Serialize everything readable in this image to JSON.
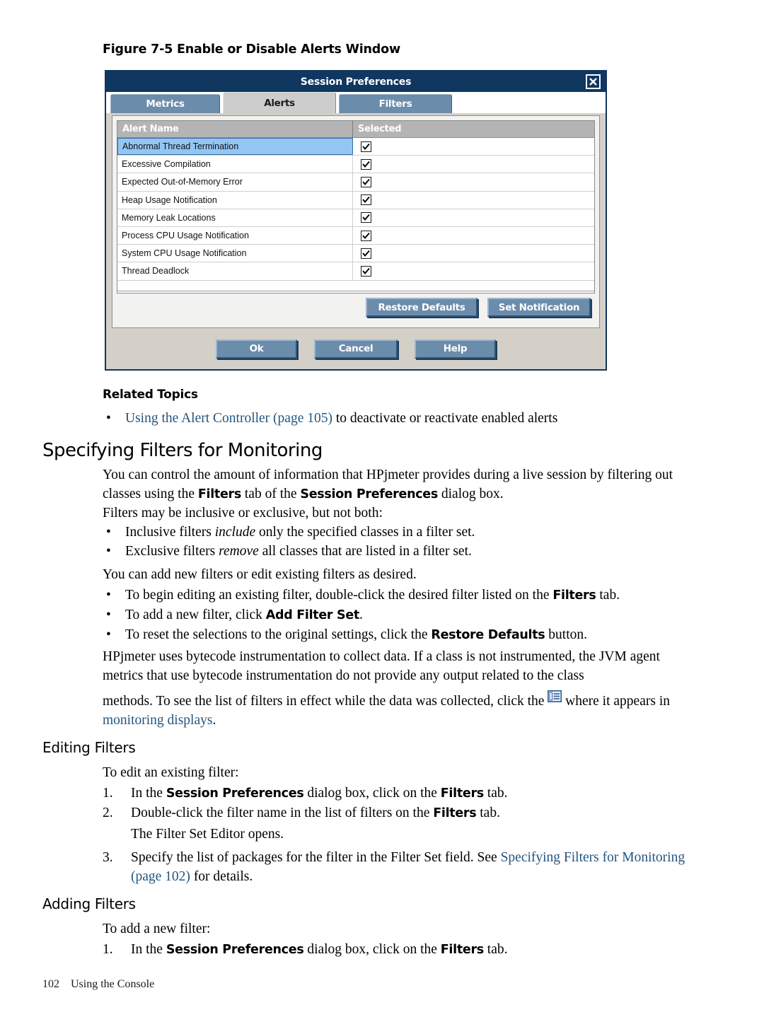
{
  "figure": {
    "caption": "Figure 7-5 Enable or Disable Alerts Window"
  },
  "dialog": {
    "title": "Session Preferences",
    "close_icon": "close-x-icon",
    "tabs": [
      {
        "label": "Metrics",
        "active": false
      },
      {
        "label": "Alerts",
        "active": true
      },
      {
        "label": "Filters",
        "active": false
      }
    ],
    "table": {
      "columns": [
        "Alert Name",
        "Selected"
      ],
      "rows": [
        {
          "name": "Abnormal Thread Termination",
          "selected": true,
          "highlighted": true
        },
        {
          "name": "Excessive Compilation",
          "selected": true,
          "highlighted": false
        },
        {
          "name": "Expected Out-of-Memory Error",
          "selected": true,
          "highlighted": false
        },
        {
          "name": "Heap Usage Notification",
          "selected": true,
          "highlighted": false
        },
        {
          "name": "Memory Leak Locations",
          "selected": true,
          "highlighted": false
        },
        {
          "name": "Process CPU Usage Notification",
          "selected": true,
          "highlighted": false
        },
        {
          "name": "System CPU Usage Notification",
          "selected": true,
          "highlighted": false
        },
        {
          "name": "Thread Deadlock",
          "selected": true,
          "highlighted": false
        }
      ]
    },
    "inner_buttons": {
      "restore_defaults": "Restore Defaults",
      "set_notification": "Set Notification"
    },
    "footer_buttons": {
      "ok": "Ok",
      "cancel": "Cancel",
      "help": "Help"
    },
    "colors": {
      "titlebar": "#0f3760",
      "tab_inactive": "#6c8cab",
      "tab_active": "#cdcdcd",
      "button": "#6c8cab",
      "row_highlight": "#93c6f5",
      "header_row": "#b4b4b4"
    }
  },
  "content": {
    "related_topics_heading": "Related Topics",
    "related_topics_bullet": {
      "link": "Using the Alert Controller (page 105)",
      "rest": " to deactivate or reactivate enabled alerts"
    },
    "section_specifying": {
      "heading": "Specifying Filters for Monitoring",
      "para1_a": "You can control the amount of information that HPjmeter provides during a live session by filtering out classes using the ",
      "para1_b": "Filters",
      "para1_c": " tab of the ",
      "para1_d": "Session Preferences",
      "para1_e": " dialog box.",
      "para2": "Filters may be inclusive or exclusive, but not both:",
      "bullet1_a": "Inclusive filters ",
      "bullet1_em": "include",
      "bullet1_b": " only the specified classes in a filter set.",
      "bullet2_a": "Exclusive filters ",
      "bullet2_em": "remove",
      "bullet2_b": " all classes that are listed in a filter set.",
      "para3": "You can add new filters or edit existing filters as desired.",
      "bullet3_a": "To begin editing an existing filter, double-click the desired filter listed on the ",
      "bullet3_b": "Filters",
      "bullet3_c": " tab.",
      "bullet4_a": "To add a new filter, click ",
      "bullet4_b": "Add Filter Set",
      "bullet4_c": ".",
      "bullet5_a": "To reset the selections to the original settings, click the ",
      "bullet5_b": "Restore Defaults",
      "bullet5_c": " button.",
      "para4_a": "HPjmeter uses bytecode instrumentation to collect data. If a class is not instrumented, the JVM agent metrics that use bytecode instrumentation do not provide any output related to the class",
      "para5_a": "methods. To see the list of filters in effect while the data was collected, click the ",
      "para5_icon": "filter-list-icon",
      "para5_b": " where it appears in ",
      "para5_link": "monitoring displays",
      "para5_c": "."
    },
    "section_editing": {
      "heading": "Editing Filters",
      "intro": "To edit an existing filter:",
      "step1_num": "1.",
      "step1_a": "In the ",
      "step1_b": "Session Preferences",
      "step1_c": " dialog box, click on the ",
      "step1_d": "Filters",
      "step1_e": " tab.",
      "step2_num": "2.",
      "step2_a": "Double-click the filter name in the list of filters on the ",
      "step2_b": "Filters",
      "step2_c": " tab.",
      "step2_note": "The Filter Set Editor opens.",
      "step3_num": "3.",
      "step3_a": "Specify the list of packages for the filter in the Filter Set field. See ",
      "step3_link": "Specifying Filters for Monitoring (page 102)",
      "step3_b": " for details."
    },
    "section_adding": {
      "heading": "Adding Filters",
      "intro": "To add a new filter:",
      "step1_num": "1.",
      "step1_a": "In the ",
      "step1_b": "Session Preferences",
      "step1_c": " dialog box, click on the ",
      "step1_d": "Filters",
      "step1_e": " tab."
    }
  },
  "page_footer": {
    "page_number": "102",
    "section_title": "Using the Console"
  }
}
